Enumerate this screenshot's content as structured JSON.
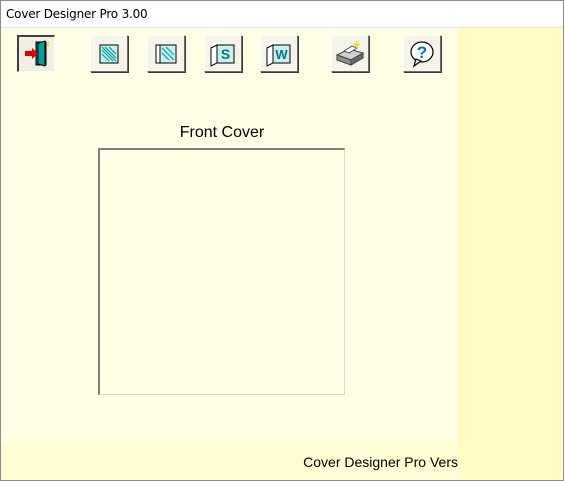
{
  "window": {
    "title": "Cover Designer Pro 3.00"
  },
  "toolbar": {
    "buttons": [
      {
        "id": "exit",
        "icon": "exit-door-icon"
      },
      {
        "id": "single-cover",
        "icon": "single-cover-icon"
      },
      {
        "id": "double-cover",
        "icon": "double-cover-icon"
      },
      {
        "id": "s-fold",
        "icon": "s-fold-cover-icon",
        "glyph": "S"
      },
      {
        "id": "w-fold",
        "icon": "w-fold-cover-icon",
        "glyph": "W"
      },
      {
        "id": "print",
        "icon": "printer-icon"
      },
      {
        "id": "help",
        "icon": "help-question-icon",
        "glyph": "?"
      }
    ]
  },
  "preview": {
    "caption": "Front Cover"
  },
  "status": {
    "text": "Cover Designer Pro Vers"
  },
  "colors": {
    "panel": "#ffffe6",
    "background": "#fffdd4",
    "accent_teal": "#009a9a"
  }
}
